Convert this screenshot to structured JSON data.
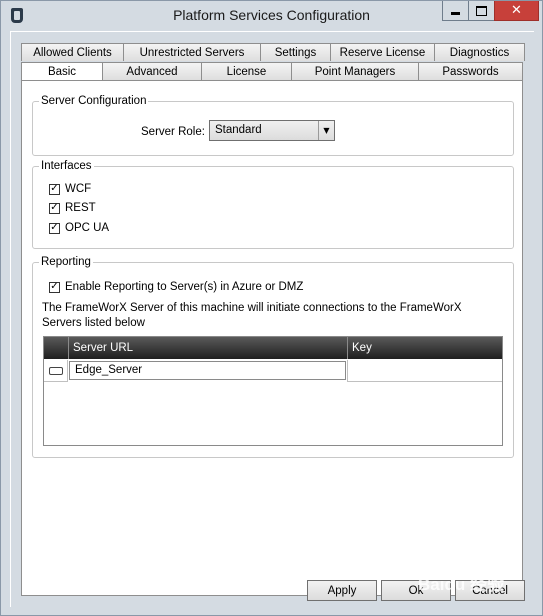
{
  "window": {
    "title": "Platform Services Configuration"
  },
  "tabs": {
    "row1": [
      "Allowed Clients",
      "Unrestricted Servers",
      "Settings",
      "Reserve License",
      "Diagnostics"
    ],
    "row2": [
      "Basic",
      "Advanced",
      "License",
      "Point Managers",
      "Passwords"
    ],
    "active": "Basic"
  },
  "server_configuration": {
    "title": "Server Configuration",
    "role_label": "Server Role:",
    "role_value": "Standard"
  },
  "interfaces": {
    "title": "Interfaces",
    "items": [
      {
        "label": "WCF",
        "checked": true
      },
      {
        "label": "REST",
        "checked": true
      },
      {
        "label": "OPC UA",
        "checked": true
      }
    ]
  },
  "reporting": {
    "title": "Reporting",
    "enable_label": "Enable Reporting to Server(s) in Azure or DMZ",
    "enable_checked": true,
    "description": "The FrameWorX Server of this machine will initiate connections to the FrameWorX Servers listed below",
    "columns": [
      "Server URL",
      "Key"
    ],
    "rows": [
      {
        "server_url": "Edge_Server",
        "key": ""
      }
    ]
  },
  "buttons": {
    "apply": "Apply",
    "ok": "Ok",
    "cancel": "Cancel"
  },
  "watermark": "Baidu 经验"
}
